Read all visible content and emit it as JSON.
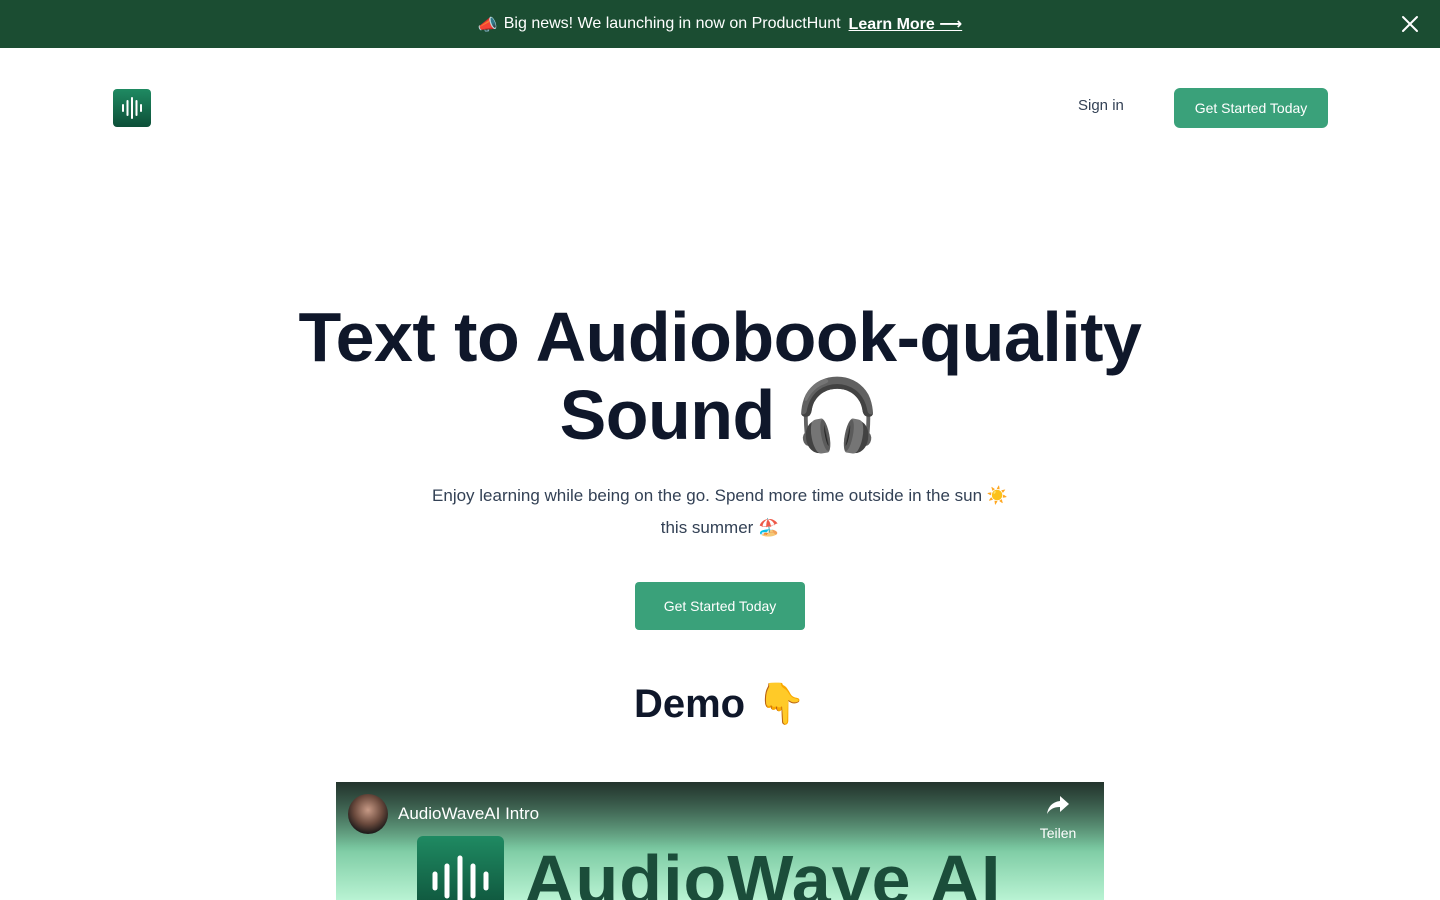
{
  "banner": {
    "emoji": "📣",
    "message": "Big news! We launching in now on ProductHunt",
    "link_label": "Learn More ⟶",
    "close_icon": "close-icon",
    "background_color": "#1b4d32"
  },
  "header": {
    "logo_icon": "soundwave-icon",
    "signin_label": "Sign in",
    "cta_label": "Get Started Today"
  },
  "hero": {
    "title_line1": "Text to Audiobook-quality",
    "title_line2": "Sound",
    "title_emoji": "🎧",
    "subtitle_line1": "Enjoy learning while being on the go. Spend more time outside in the sun",
    "subtitle_emoji1": "☀️",
    "subtitle_line2": "this summer",
    "subtitle_emoji2": "🏖️",
    "cta_label": "Get Started Today",
    "accent_color": "#3aa17a"
  },
  "demo": {
    "title": "Demo",
    "title_emoji": "👇"
  },
  "video": {
    "title": "AudioWaveAI Intro",
    "share_label": "Teilen",
    "brand_text": "AudioWave AI"
  }
}
